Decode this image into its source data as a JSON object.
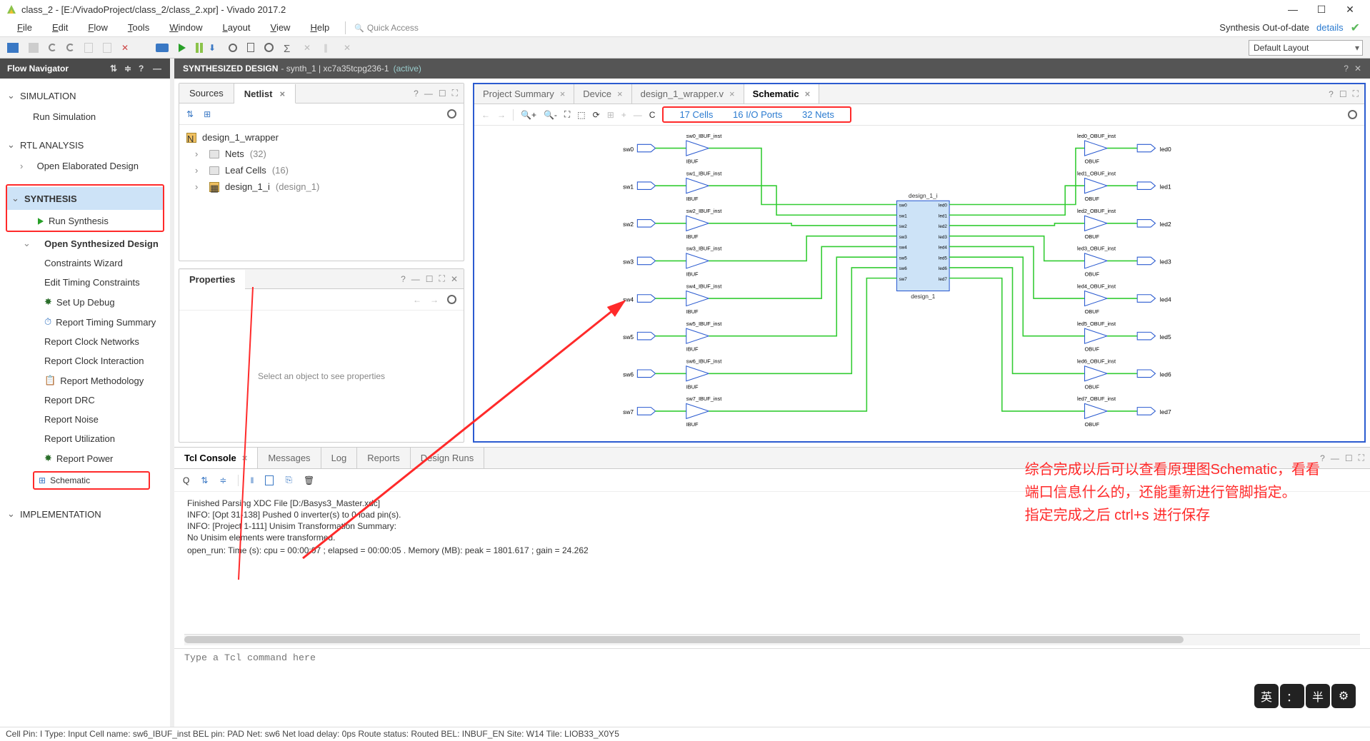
{
  "window": {
    "title": "class_2 - [E:/VivadoProject/class_2/class_2.xpr] - Vivado 2017.2"
  },
  "menus": [
    "File",
    "Edit",
    "Flow",
    "Tools",
    "Window",
    "Layout",
    "View",
    "Help"
  ],
  "quick_access": "Quick Access",
  "synth_status": "Synthesis Out-of-date",
  "details": "details",
  "layout_dd": "Default Layout",
  "flownav": {
    "title": "Flow Navigator",
    "simulation": "SIMULATION",
    "run_simulation": "Run Simulation",
    "rtl": "RTL ANALYSIS",
    "open_elab": "Open Elaborated Design",
    "synthesis": "SYNTHESIS",
    "run_synth": "Run Synthesis",
    "open_synth": "Open Synthesized Design",
    "constraints_wiz": "Constraints Wizard",
    "edit_timing": "Edit Timing Constraints",
    "setup_debug": "Set Up Debug",
    "rpt_timing": "Report Timing Summary",
    "rpt_clock_net": "Report Clock Networks",
    "rpt_clock_int": "Report Clock Interaction",
    "rpt_method": "Report Methodology",
    "rpt_drc": "Report DRC",
    "rpt_noise": "Report Noise",
    "rpt_util": "Report Utilization",
    "rpt_power": "Report Power",
    "schematic": "Schematic",
    "impl": "IMPLEMENTATION"
  },
  "banner": {
    "title": "SYNTHESIZED DESIGN",
    "sub": " - synth_1 | xc7a35tcpg236-1",
    "active": "(active)"
  },
  "netlist": {
    "tab_sources": "Sources",
    "tab_netlist": "Netlist",
    "root": "design_1_wrapper",
    "nets": "Nets",
    "nets_count": "(32)",
    "leaf": "Leaf Cells",
    "leaf_count": "(16)",
    "inst": "design_1_i",
    "inst_type": "(design_1)"
  },
  "properties": {
    "title": "Properties",
    "empty": "Select an object to see properties"
  },
  "schtabs": {
    "summary": "Project Summary",
    "device": "Device",
    "wrapper": "design_1_wrapper.v",
    "schematic": "Schematic"
  },
  "schstats": {
    "cells": "17 Cells",
    "ports": "16 I/O Ports",
    "nets": "32 Nets"
  },
  "schematic_labels": {
    "sw": [
      "sw0",
      "sw1",
      "sw2",
      "sw3",
      "sw4",
      "sw5",
      "sw6",
      "sw7"
    ],
    "ibuf": [
      "sw0_IBUF_inst",
      "sw1_IBUF_inst",
      "sw2_IBUF_inst",
      "sw3_IBUF_inst",
      "sw4_IBUF_inst",
      "sw5_IBUF_inst",
      "sw6_IBUF_inst",
      "sw7_IBUF_inst"
    ],
    "ibuf_t": "IBUF",
    "block": "design_1_i",
    "block_t": "design_1",
    "obuf": [
      "led0_OBUF_inst",
      "led1_OBUF_inst",
      "led2_OBUF_inst",
      "led3_OBUF_inst",
      "led4_OBUF_inst",
      "led5_OBUF_inst",
      "led6_OBUF_inst",
      "led7_OBUF_inst"
    ],
    "obuf_t": "OBUF",
    "led": [
      "led0",
      "led1",
      "led2",
      "led3",
      "led4",
      "led5",
      "led6",
      "led7"
    ]
  },
  "btabs": {
    "tcl": "Tcl Console",
    "messages": "Messages",
    "log": "Log",
    "reports": "Reports",
    "runs": "Design Runs"
  },
  "console_lines": [
    "Finished Parsing XDC File [D:/Basys3_Master.xdc]",
    "INFO: [Opt 31-138] Pushed 0 inverter(s) to 0 load pin(s).",
    "INFO: [Project 1-111] Unisim Transformation Summary:",
    "No Unisim elements were transformed.",
    "",
    "open_run: Time (s): cpu = 00:00:07 ; elapsed = 00:00:05 . Memory (MB): peak = 1801.617 ; gain = 24.262"
  ],
  "tcl_placeholder": "Type a Tcl command here",
  "annotation": "综合完成以后可以查看原理图Schematic，看看\n端口信息什么的，还能重新进行管脚指定。\n指定完成之后 ctrl+s 进行保存",
  "statusbar": "Cell Pin: I   Type: Input   Cell name: sw6_IBUF_inst   BEL pin: PAD   Net: sw6   Net load delay: 0ps   Route status: Routed   BEL: INBUF_EN   Site: W14   Tile: LIOB33_X0Y5",
  "ime": [
    "英",
    "：",
    "半",
    "⚙"
  ]
}
